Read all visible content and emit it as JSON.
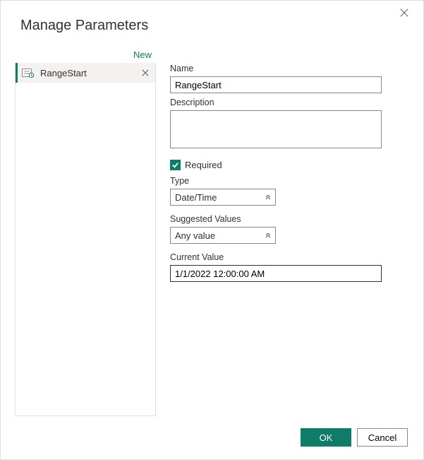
{
  "dialog": {
    "title": "Manage Parameters"
  },
  "sidebar": {
    "new_label": "New",
    "items": [
      {
        "name": "RangeStart"
      }
    ]
  },
  "form": {
    "name_label": "Name",
    "name_value": "RangeStart",
    "description_label": "Description",
    "description_value": "",
    "required_label": "Required",
    "required_checked": true,
    "type_label": "Type",
    "type_value": "Date/Time",
    "suggested_label": "Suggested Values",
    "suggested_value": "Any value",
    "current_label": "Current Value",
    "current_value": "1/1/2022 12:00:00 AM"
  },
  "footer": {
    "ok_label": "OK",
    "cancel_label": "Cancel"
  }
}
